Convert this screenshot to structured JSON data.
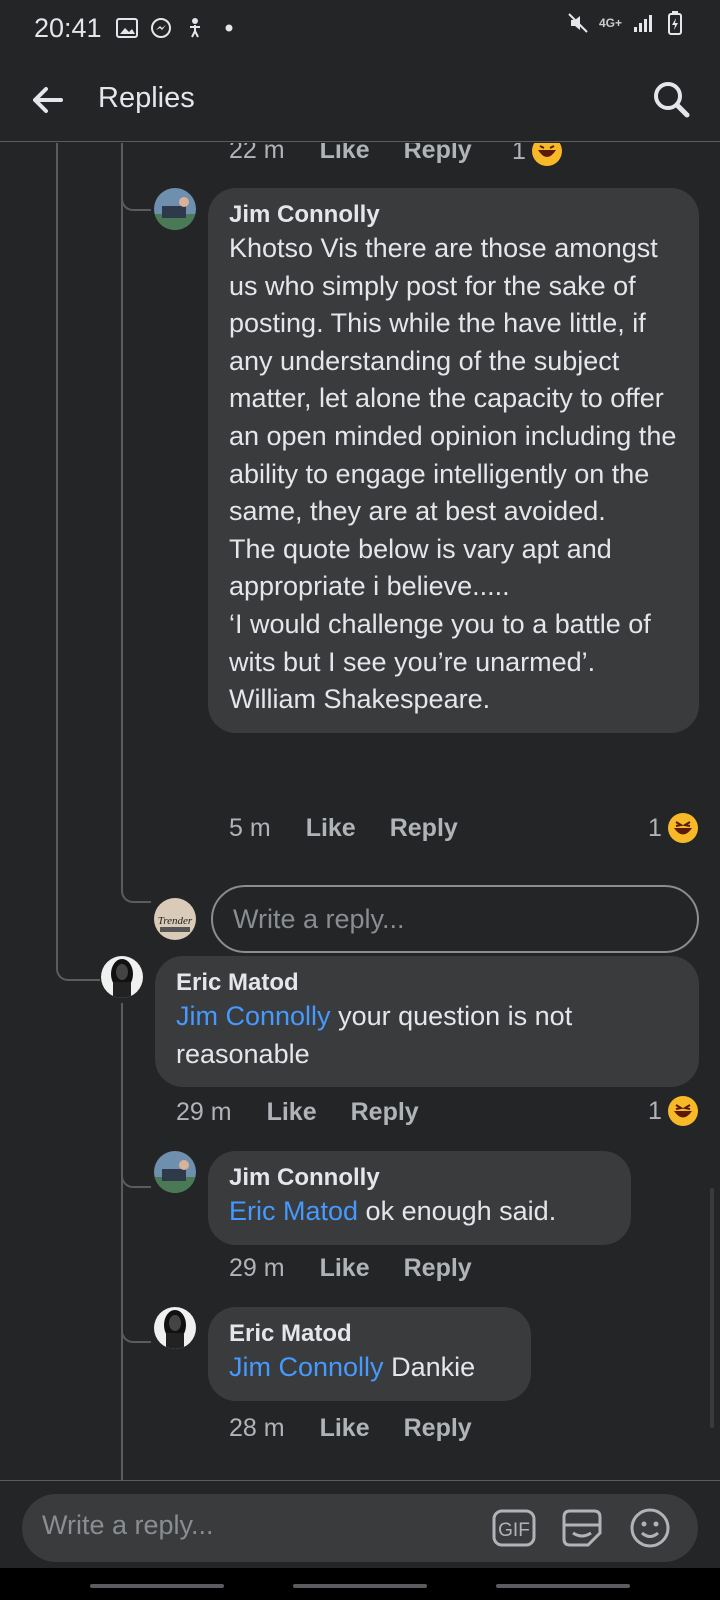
{
  "status_bar": {
    "time": "20:41",
    "network": "4G+",
    "icons": [
      "image-icon",
      "messenger-icon",
      "accessibility-icon",
      "dot-icon",
      "mute-icon",
      "signal-icon",
      "battery-icon"
    ]
  },
  "header": {
    "title": "Replies",
    "back_icon": "back-arrow-icon",
    "search_icon": "search-icon"
  },
  "top_partial": {
    "time": "22 m",
    "like": "Like",
    "reply": "Reply",
    "reaction_count": "1"
  },
  "comments": [
    {
      "author": "Jim Connolly",
      "mention": "",
      "text": "Khotso Vis there are those amongst us who simply post for the sake of posting. This while the have little, if any understanding of the subject matter, let alone the capacity to offer an open minded opinion including the ability to engage intelligently on the same, they are at best avoided.\nThe quote below is vary apt and appropriate i believe.....\n‘I would challenge you to a battle of wits but I see you’re unarmed’. William Shakespeare.",
      "time": "5 m",
      "like": "Like",
      "reply": "Reply",
      "reaction_count": "1"
    },
    {
      "author": "Eric Matod",
      "mention": "Jim Connolly",
      "text": " your question is not reasonable",
      "time": "29 m",
      "like": "Like",
      "reply": "Reply",
      "reaction_count": "1"
    },
    {
      "author": "Jim Connolly",
      "mention": "Eric Matod",
      "text": " ok enough said.",
      "time": "29 m",
      "like": "Like",
      "reply": "Reply"
    },
    {
      "author": "Eric Matod",
      "mention": "Jim Connolly",
      "text": " Dankie",
      "time": "28 m",
      "like": "Like",
      "reply": "Reply"
    }
  ],
  "inline_reply": {
    "placeholder": "Write a reply..."
  },
  "composer": {
    "placeholder": "Write a reply...",
    "gif_label": "GIF",
    "sticker_icon": "sticker-icon",
    "emoji_icon": "emoji-icon"
  },
  "colors": {
    "background": "#242526",
    "bubble": "#3a3b3c",
    "mention": "#4599ff",
    "meta_text": "#b0b3b8",
    "reaction": "#f7b928"
  }
}
